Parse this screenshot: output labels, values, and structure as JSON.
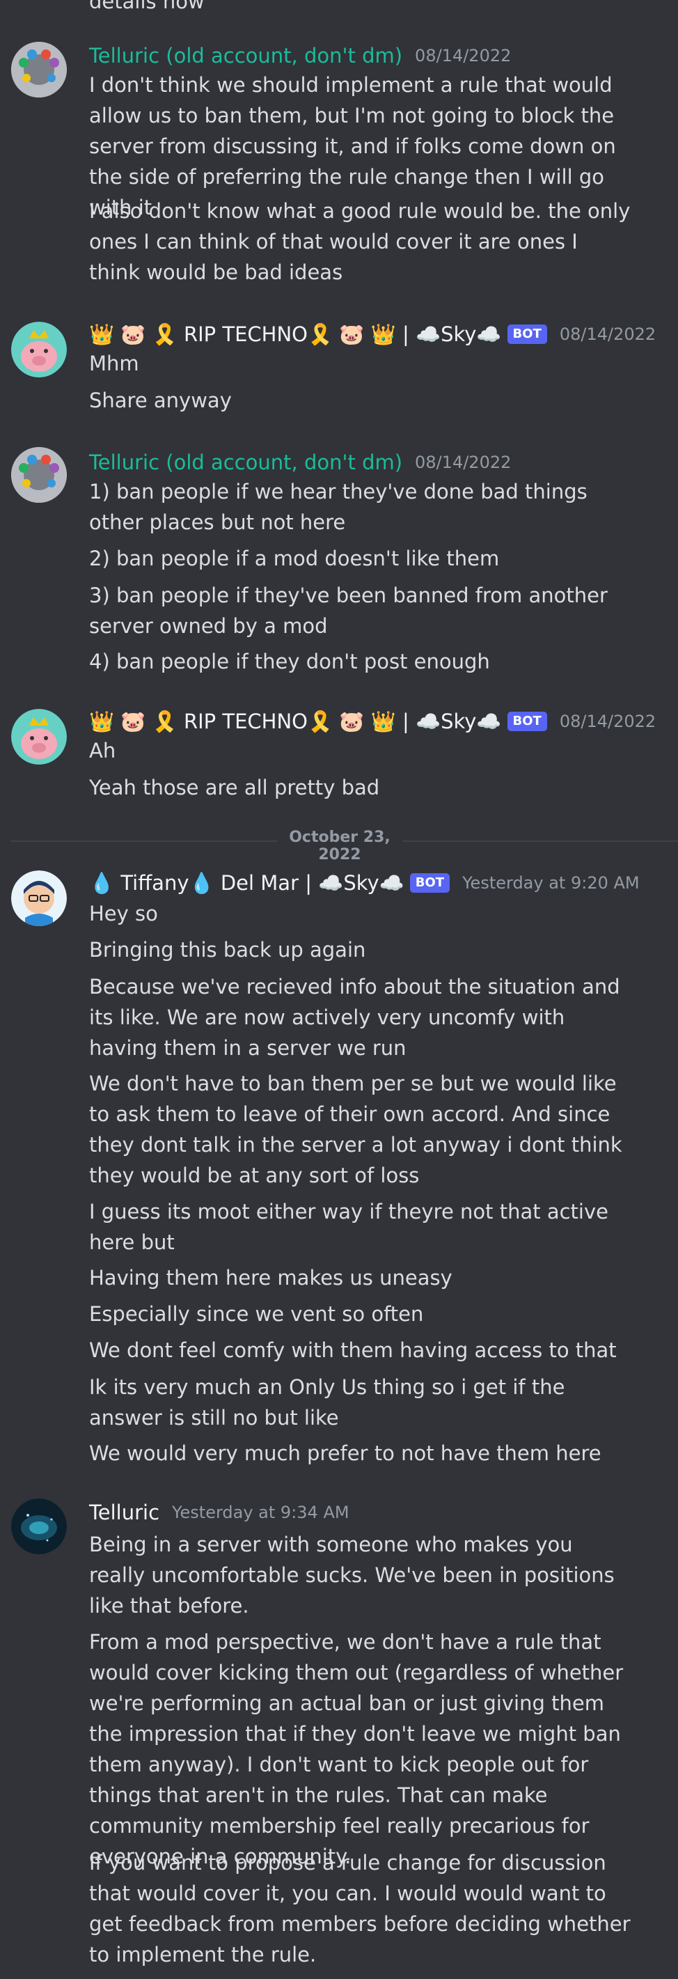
{
  "top_cut_text": "details now",
  "messages": [
    {
      "author": "Telluric (old account, don't dm)",
      "timestamp": "08/14/2022",
      "lines": [
        "I don't think we should implement a rule that would allow us to ban them, but I'm not going to block the server from discussing it, and if folks come down on the side of preferring the rule change then I will go with it",
        "I also don't know what a good rule would be. the only ones I can think of that would cover it are ones I think would be bad ideas"
      ]
    },
    {
      "author_prefix": "👑 🐷 🎗️ RIP TECHNO🎗️ 🐷 👑",
      "author_suffix": "| ☁️Sky☁️",
      "bot_tag": "BOT",
      "timestamp": "08/14/2022",
      "lines": [
        "Mhm",
        "Share anyway"
      ]
    },
    {
      "author": "Telluric (old account, don't dm)",
      "timestamp": "08/14/2022",
      "lines": [
        "1) ban people if we hear they've done bad things other places but not here",
        "2) ban people if a mod doesn't like them",
        "3) ban people if they've been banned from another server owned by a mod",
        "4) ban people if they don't post enough"
      ]
    },
    {
      "author_prefix": "👑 🐷 🎗️ RIP TECHNO🎗️ 🐷 👑",
      "author_suffix": "| ☁️Sky☁️",
      "bot_tag": "BOT",
      "timestamp": "08/14/2022",
      "lines": [
        "Ah",
        "Yeah those are all pretty bad"
      ]
    },
    {
      "author_prefix": "💧 Tiffany💧  Del Mar",
      "author_suffix": "| ☁️Sky☁️",
      "bot_tag": "BOT",
      "timestamp": "Yesterday at 9:20 AM",
      "lines": [
        "Hey so",
        "Bringing this back up again",
        "Because we've recieved info about the situation and its like. We are now actively very uncomfy with having them in a server we run",
        "We don't have to ban them per se but we would like to ask them to leave of their own accord. And since they dont talk in the server a lot anyway i dont think they would be at any sort of loss",
        "I guess its moot either way if theyre not that active here but",
        "Having them here makes us uneasy",
        "Especially since we vent so often",
        "We dont feel comfy with them having access to that",
        "Ik its very much an Only Us thing so i get if the answer is still no but like",
        "We would very much prefer to not have them here"
      ]
    },
    {
      "author": "Telluric",
      "timestamp": "Yesterday at 9:34 AM",
      "lines": [
        "Being in a server with someone who makes you really uncomfortable sucks. We've been in positions like that before.",
        "From a mod perspective, we don't have a rule that would cover kicking them out (regardless of whether we're performing an actual ban or just giving them the impression that if they don't leave we might ban them anyway). I don't want to kick people out for things that aren't in the rules. That can make community membership feel really precarious for everyone in a community.",
        "If you want to propose a rule change for discussion that would cover it, you can. I would would want to get feedback from members before deciding whether to implement the rule."
      ]
    }
  ],
  "date_divider": "October 23, 2022"
}
